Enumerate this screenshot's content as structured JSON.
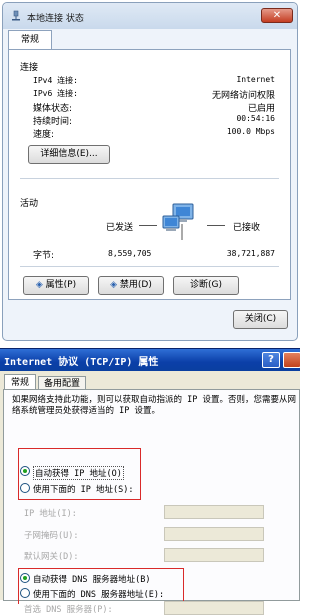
{
  "status_window": {
    "title": "本地连接 状态",
    "close_glyph": "✕",
    "tab": "常规",
    "connection": {
      "section": "连接",
      "rows": [
        {
          "label": "IPv4 连接:",
          "value": "Internet"
        },
        {
          "label": "IPv6 连接:",
          "value": "无网络访问权限"
        },
        {
          "label": "媒体状态:",
          "value": "已启用"
        },
        {
          "label": "持续时间:",
          "value": "00:54:16"
        },
        {
          "label": "速度:",
          "value": "100.0 Mbps"
        }
      ],
      "details_button": "详细信息(E)..."
    },
    "activity": {
      "section": "活动",
      "sent_label": "已发送",
      "received_label": "已接收",
      "bytes_label": "字节:",
      "bytes_sent": "8,559,705",
      "bytes_received": "38,721,887"
    },
    "buttons": {
      "properties": "属性(P)",
      "disable": "禁用(D)",
      "diagnose": "诊断(G)",
      "close": "关闭(C)"
    },
    "icons": [
      "network-icon",
      "network-computers-icon",
      "shield-icon"
    ]
  },
  "tcpip_window": {
    "title": "Internet 协议 (TCP/IP) 属性",
    "help_glyph": "?",
    "tabs": [
      "常规",
      "备用配置"
    ],
    "description": "如果网络支持此功能，则可以获取自动指派的 IP 设置。否则，您需要从网络系统管理员处获得适当的 IP 设置。",
    "ip": {
      "auto_label": "自动获得 IP 地址(O)",
      "manual_label": "使用下面的 IP 地址(S):",
      "selected": "auto",
      "fields": [
        "IP 地址(I):",
        "子网掩码(U):",
        "默认网关(D):"
      ]
    },
    "dns": {
      "auto_label": "自动获得 DNS 服务器地址(B)",
      "manual_label": "使用下面的 DNS 服务器地址(E):",
      "selected": "auto",
      "preferred_label": "首选 DNS 服务器(P):"
    }
  }
}
